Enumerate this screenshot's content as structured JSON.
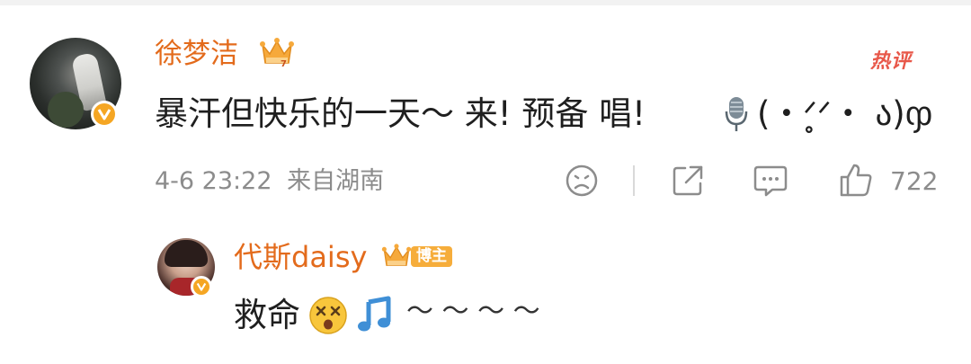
{
  "comment": {
    "username": "徐梦洁",
    "hot_tag": "热评",
    "text": "暴汗但快乐的一天～ 来! 预备 唱!",
    "kaomoji": "(・ᐟ̥ᐟ・ ა)ჶ",
    "timestamp": "4-6 23:22",
    "location": "来自湖南",
    "like_count": "722"
  },
  "reply": {
    "username": "代斯daisy",
    "badge_label": "博主",
    "text": "救命",
    "tildes": "～ ～ ～ ～"
  },
  "colors": {
    "username": "#e36b1c",
    "verified_badge": "#f5a623",
    "hot_tag": "#e8584a",
    "meta_text": "#8c8c8c"
  },
  "icons": [
    "crown-icon",
    "verified-icon",
    "hot-comment-tag",
    "microphone-icon",
    "sad-face-icon",
    "share-icon",
    "comment-icon",
    "thumbs-up-icon",
    "dizzy-face-icon",
    "music-note-icon"
  ]
}
